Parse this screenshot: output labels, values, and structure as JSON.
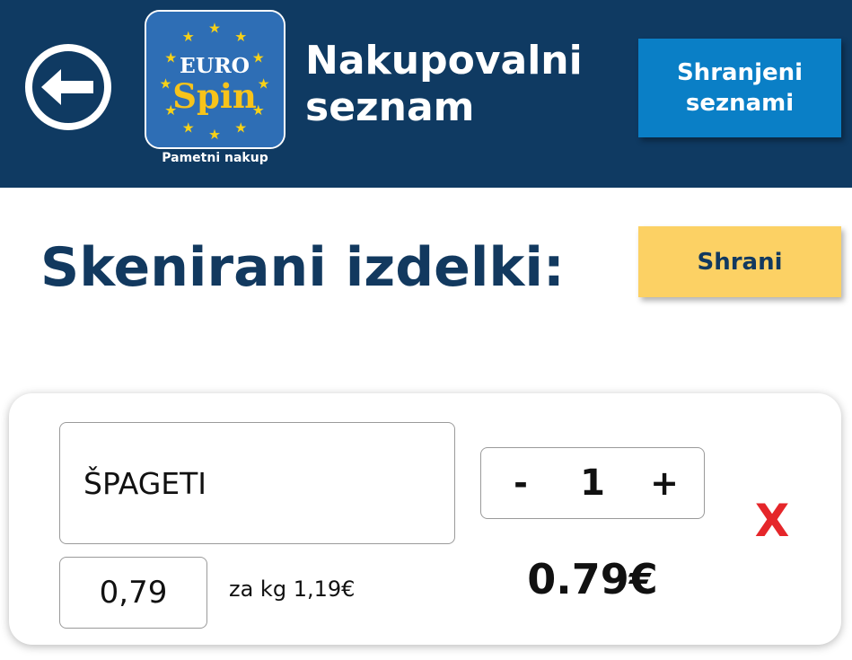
{
  "colors": {
    "header_bg": "#0f3a62",
    "primary_blue": "#0a7fc6",
    "save_yellow": "#fcd164",
    "title_navy": "#12395f",
    "remove_red": "#e5262a"
  },
  "header": {
    "back_icon": "arrow-left-circle-icon",
    "logo": {
      "word_top": "EURO",
      "word_bottom": "Spin",
      "caption": "Pametni nakup"
    },
    "title_line1": "Nakupovalni",
    "title_line2": "seznam",
    "saved_lists_line1": "Shranjeni",
    "saved_lists_line2": "seznami"
  },
  "main": {
    "section_title": "Skenirani izdelki:",
    "save_label": "Shrani"
  },
  "items": [
    {
      "name": "ŠPAGETI",
      "quantity": "1",
      "minus_label": "-",
      "plus_label": "+",
      "remove_label": "X",
      "price": "0,79",
      "unit_price": "za kg 1,19€",
      "total": "0.79€"
    }
  ]
}
